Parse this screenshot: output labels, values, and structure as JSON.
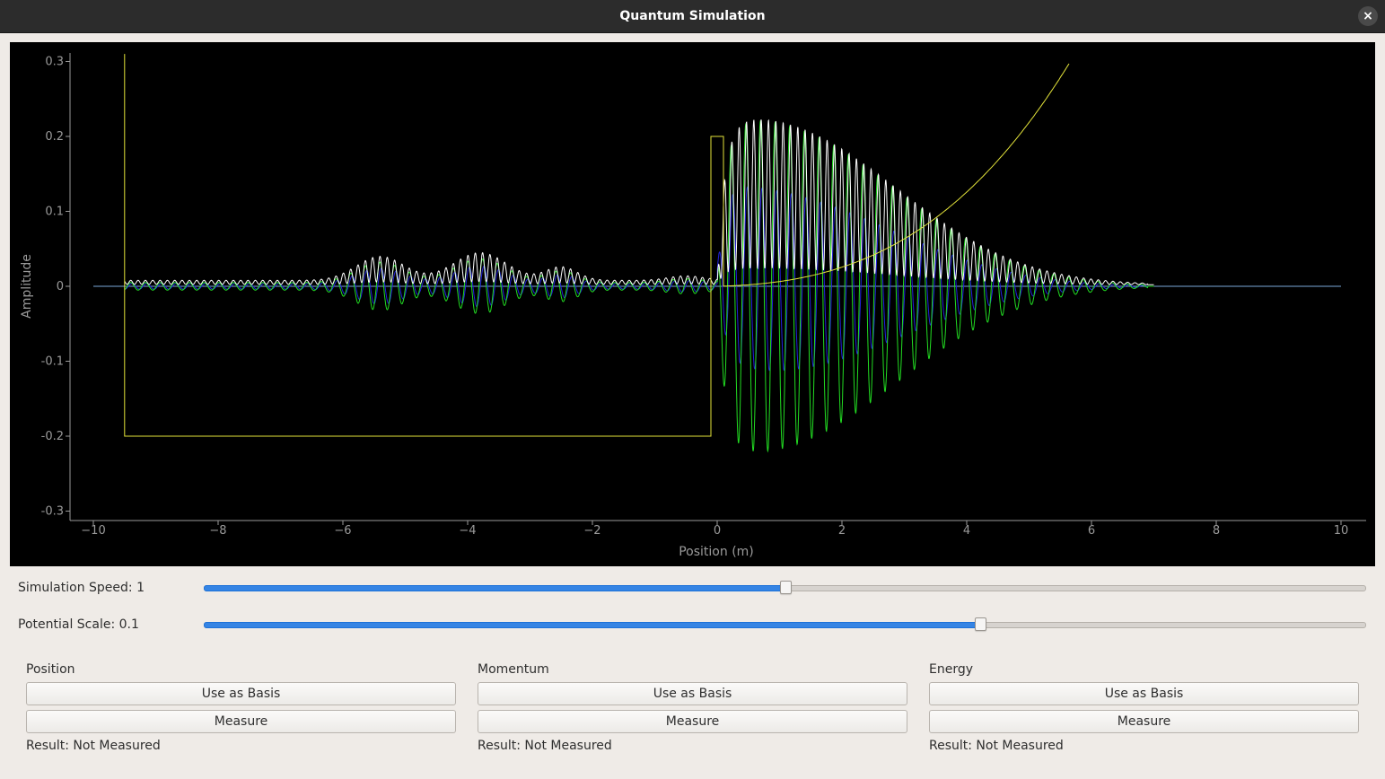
{
  "window": {
    "title": "Quantum Simulation",
    "close_glyph": "×"
  },
  "chart_data": {
    "type": "line",
    "xlabel": "Position (m)",
    "ylabel": "Amplitude",
    "xlim": [
      -10,
      10
    ],
    "ylim": [
      -0.31,
      0.31
    ],
    "x_ticks": [
      -10,
      -8,
      -6,
      -4,
      -2,
      0,
      2,
      4,
      6,
      8,
      10
    ],
    "x_tick_labels": [
      "−10",
      "−8",
      "−6",
      "−4",
      "−2",
      "0",
      "2",
      "4",
      "6",
      "8",
      "10"
    ],
    "y_ticks": [
      -0.3,
      -0.2,
      -0.1,
      0,
      0.1,
      0.2,
      0.3
    ],
    "y_tick_labels": [
      "-0.3",
      "-0.2",
      "-0.1",
      "0",
      "0.1",
      "0.2",
      "0.3"
    ],
    "grid": false,
    "legend": "none",
    "background": "#000000",
    "series": [
      {
        "role": "potential",
        "color": "#e3e33a",
        "description_points": [
          [
            -9.5,
            0.31
          ],
          [
            -9.5,
            -0.2
          ],
          [
            -0.1,
            -0.2
          ],
          [
            -0.1,
            0.2
          ],
          [
            0.1,
            0.2
          ],
          [
            0.1,
            0.0
          ],
          [
            1.0,
            0.01
          ],
          [
            2.0,
            0.027
          ],
          [
            3.0,
            0.061
          ],
          [
            4.0,
            0.115
          ],
          [
            5.0,
            0.197
          ],
          [
            5.65,
            0.31
          ]
        ]
      },
      {
        "role": "magnitude",
        "color": "#ffffff",
        "envelope": {
          "left_lobes": [
            {
              "center": -5.4,
              "width": 0.9,
              "peak": 0.032
            },
            {
              "center": -3.8,
              "width": 1.0,
              "peak": 0.037
            },
            {
              "center": -2.5,
              "width": 0.6,
              "peak": 0.018
            }
          ],
          "right_lobe_peak_x": 0.45,
          "right_lobe_peak": 0.222,
          "tail_end_x": 6.9,
          "oscillation_period": 0.235
        }
      },
      {
        "role": "real",
        "color": "#22dd22"
      },
      {
        "role": "imaginary",
        "color": "#2222dd"
      }
    ]
  },
  "controls": {
    "speed": {
      "label": "Simulation Speed: 1",
      "value_fraction": 0.5
    },
    "potential": {
      "label": "Potential Scale: 0.1",
      "value_fraction": 0.668
    }
  },
  "groups": [
    {
      "title": "Position",
      "basis_label": "Use as Basis",
      "measure_label": "Measure",
      "result": "Result: Not Measured"
    },
    {
      "title": "Momentum",
      "basis_label": "Use as Basis",
      "measure_label": "Measure",
      "result": "Result: Not Measured"
    },
    {
      "title": "Energy",
      "basis_label": "Use as Basis",
      "measure_label": "Measure",
      "result": "Result: Not Measured"
    }
  ]
}
